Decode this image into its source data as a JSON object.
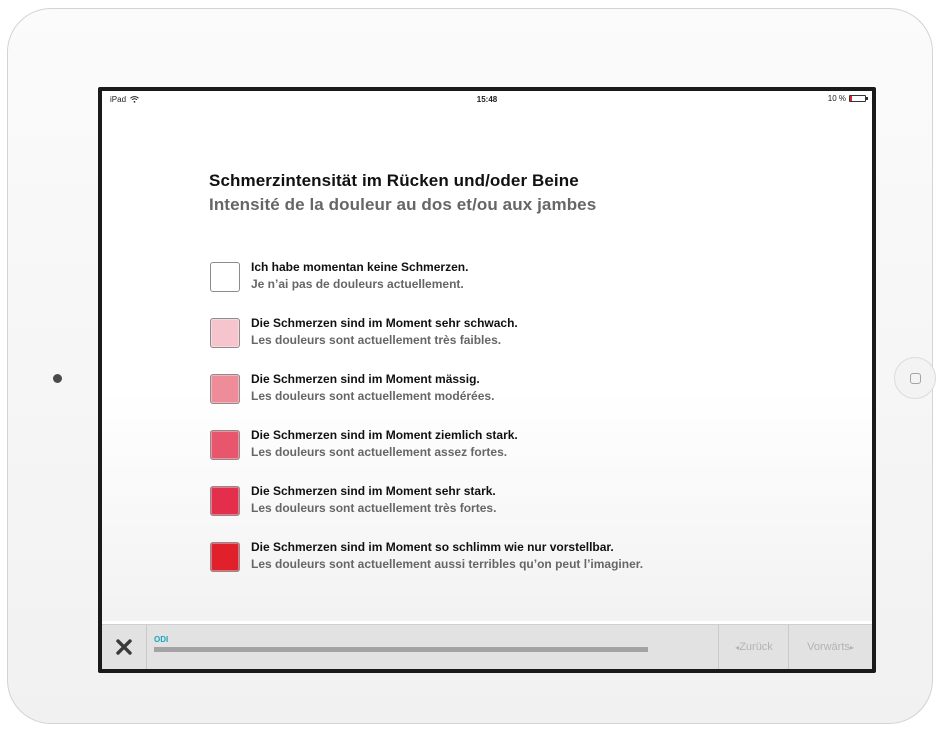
{
  "status_bar": {
    "device": "iPad",
    "wifi_icon": "wifi-icon",
    "time": "15:48",
    "battery_text": "10 %",
    "battery_level": 0.1
  },
  "question": {
    "title_de": "Schmerzintensität im Rücken und/oder Beine",
    "title_fr": "Intensité de la douleur au dos et/ou aux jambes"
  },
  "options": [
    {
      "de": "Ich habe momentan keine Schmerzen.",
      "fr": "Je n’ai pas de douleurs actuellement.",
      "color": "#ffffff"
    },
    {
      "de": "Die Schmerzen sind im Moment sehr schwach.",
      "fr": "Les douleurs sont actuellement très faibles.",
      "color": "#f6c4cd"
    },
    {
      "de": "Die Schmerzen sind im Moment mässig.",
      "fr": "Les douleurs sont actuellement modérées.",
      "color": "#ee8c99"
    },
    {
      "de": "Die Schmerzen sind im Moment ziemlich stark.",
      "fr": "Les douleurs sont actuellement assez fortes.",
      "color": "#e7566c"
    },
    {
      "de": "Die Schmerzen sind im Moment sehr stark.",
      "fr": "Les douleurs sont actuellement très fortes.",
      "color": "#e32f4b"
    },
    {
      "de": "Die Schmerzen sind im Moment so schlimm wie nur vorstellbar.",
      "fr": "Les douleurs sont actuellement aussi terribles qu’on peut l’imaginer.",
      "color": "#e0202b"
    }
  ],
  "bottom_bar": {
    "close_icon": "close-icon",
    "progress_label": "ODI",
    "progress_value": 1.0,
    "back_label": "Zurück",
    "next_label": "Vorwärts",
    "back_chevron": "◂",
    "next_chevron": "▸"
  }
}
